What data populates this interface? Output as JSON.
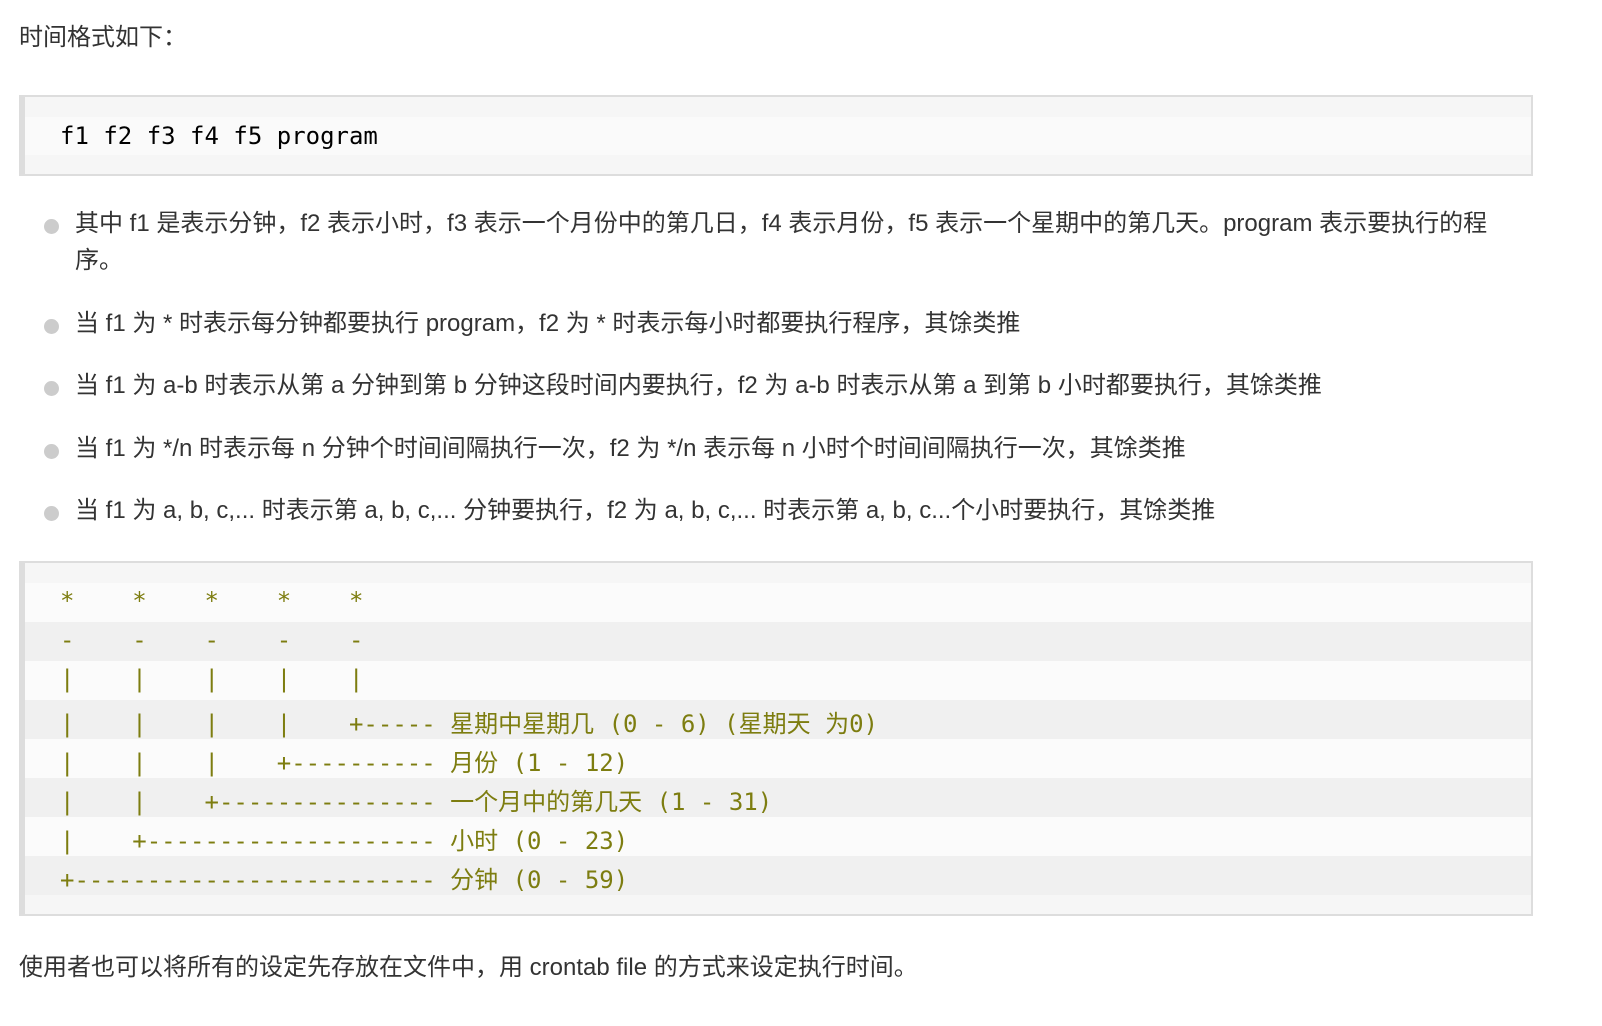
{
  "intro": "时间格式如下：",
  "code1": "f1 f2 f3 f4 f5 program",
  "bullets": [
    "其中 f1 是表示分钟，f2 表示小时，f3 表示一个月份中的第几日，f4 表示月份，f5 表示一个星期中的第几天。program 表示要执行的程序。",
    "当 f1 为 * 时表示每分钟都要执行 program，f2 为 * 时表示每小时都要执行程序，其馀类推",
    "当 f1 为 a-b 时表示从第 a 分钟到第 b 分钟这段时间内要执行，f2 为 a-b 时表示从第 a 到第 b 小时都要执行，其馀类推",
    "当 f1 为 */n 时表示每 n 分钟个时间间隔执行一次，f2 为 */n 表示每 n 小时个时间间隔执行一次，其馀类推",
    "当 f1 为 a, b, c,... 时表示第 a, b, c,... 分钟要执行，f2 为 a, b, c,... 时表示第 a, b, c...个小时要执行，其馀类推"
  ],
  "diagram": {
    "lines": [
      "*    *    *    *    *",
      "-    -    -    -    -",
      "|    |    |    |    |",
      "|    |    |    |    +----- 星期中星期几 (0 - 6) (星期天 为0)",
      "|    |    |    +---------- 月份 (1 - 12)",
      "|    |    +--------------- 一个月中的第几天 (1 - 31)",
      "|    +-------------------- 小时 (0 - 23)",
      "+------------------------- 分钟 (0 - 59)"
    ]
  },
  "outro": "使用者也可以将所有的设定先存放在文件中，用 crontab file 的方式来设定执行时间。"
}
